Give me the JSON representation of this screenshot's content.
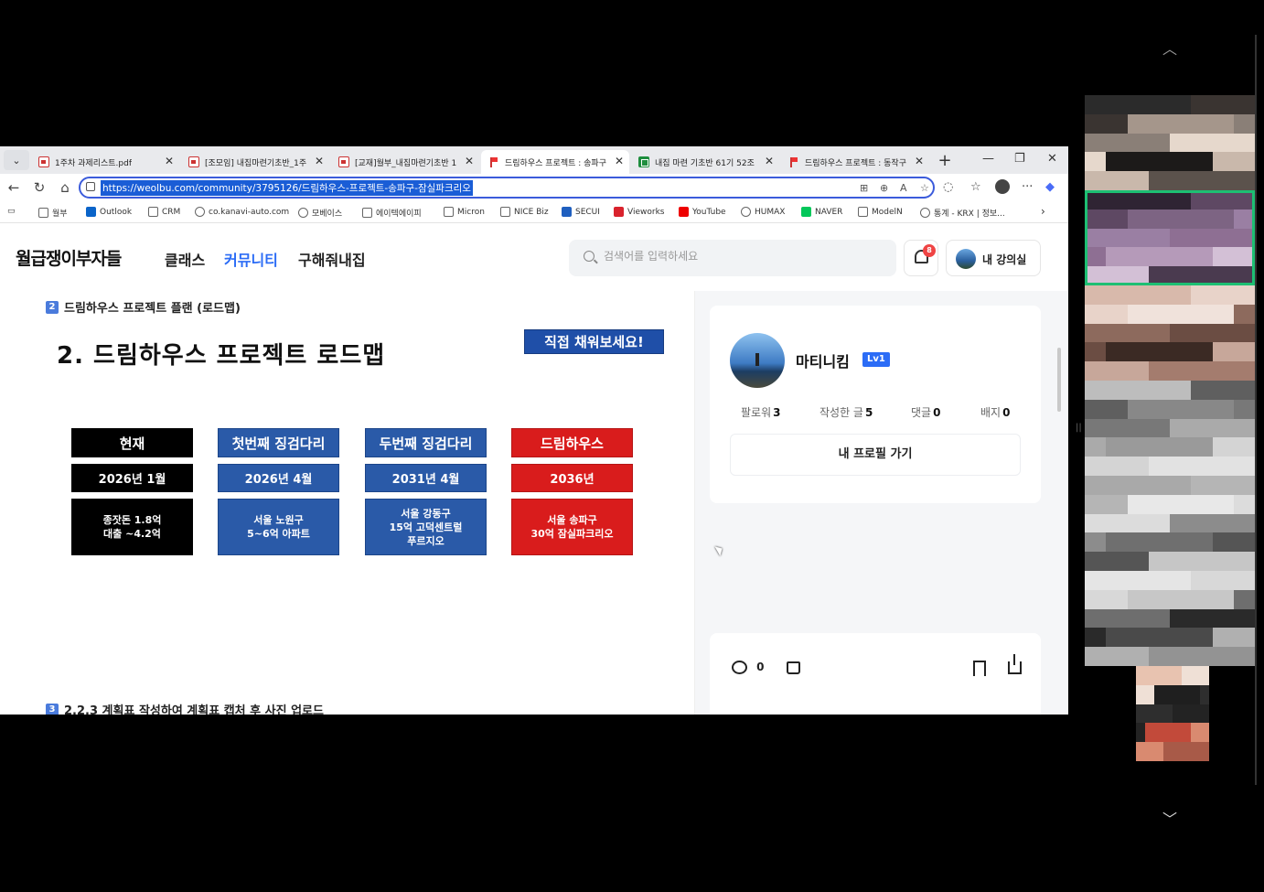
{
  "browser": {
    "tabs": [
      {
        "label": "1주차 과제리스트.pdf",
        "icon": "pdf-icon",
        "active": false
      },
      {
        "label": "[조모임] 내집마련기초반_1주",
        "icon": "pdf-icon",
        "active": false
      },
      {
        "label": "[교재]월부_내집마련기초반 1",
        "icon": "pdf-icon",
        "active": false
      },
      {
        "label": "드림하우스 프로젝트 : 송파구",
        "icon": "flag-icon",
        "active": true
      },
      {
        "label": "내집 마련 기초반 61기 52조",
        "icon": "sheet-icon",
        "active": false
      },
      {
        "label": "드림하우스 프로젝트 : 동작구",
        "icon": "flag-icon",
        "active": false
      }
    ],
    "url": "https://weolbu.com/community/3795126/드림하우스-프로젝트-송파구-잠실파크리오",
    "bookmarks": [
      {
        "label": "월부",
        "icon": "folder-icon"
      },
      {
        "label": "Outlook",
        "icon": "outlook-icon"
      },
      {
        "label": "CRM",
        "icon": "hand-icon"
      },
      {
        "label": "co.kanavi-auto.com",
        "icon": "globe-icon"
      },
      {
        "label": "모베이스",
        "icon": "globe-icon"
      },
      {
        "label": "에이텍에이피",
        "icon": "iu-icon"
      },
      {
        "label": "Micron",
        "icon": "micron-icon"
      },
      {
        "label": "NICE Biz",
        "icon": "nice-icon"
      },
      {
        "label": "SECUI",
        "icon": "secui-icon"
      },
      {
        "label": "Vieworks",
        "icon": "vieworks-icon"
      },
      {
        "label": "YouTube",
        "icon": "youtube-icon"
      },
      {
        "label": "HUMAX",
        "icon": "globe-icon"
      },
      {
        "label": "NAVER",
        "icon": "naver-icon"
      },
      {
        "label": "ModelN",
        "icon": "modeln-icon"
      },
      {
        "label": "통계 - KRX | 정보...",
        "icon": "globe-icon"
      }
    ]
  },
  "site": {
    "logo": "월급쟁이부자들",
    "nav": [
      {
        "label": "클래스",
        "active": false
      },
      {
        "label": "커뮤니티",
        "active": true
      },
      {
        "label": "구해줘내집",
        "active": false
      }
    ],
    "search_placeholder": "검색어를 입력하세요",
    "notification_count": "8",
    "my_course_label": "내 강의실"
  },
  "slide": {
    "section_number": "2",
    "section_title": "드림하우스 프로젝트 플랜 (로드맵)",
    "title": "2. 드림하우스 프로젝트 로드맵",
    "badge": "직접 채워보세요!",
    "columns": [
      {
        "header": "현재",
        "date": "2026년 1월",
        "body": "종잣돈 1.8억\n대출 ~4.2억",
        "color": "#000000"
      },
      {
        "header": "첫번째 징검다리",
        "date": "2026년 4월",
        "body": "서울 노원구\n5~6억 아파트",
        "color": "#2a5aa8"
      },
      {
        "header": "두번째 징검다리",
        "date": "2031년 4월",
        "body": "서울 강동구\n15억 고덕센트럴\n푸르지오",
        "color": "#2a5aa8"
      },
      {
        "header": "드림하우스",
        "date": "2036년",
        "body": "서울 송파구\n30억 잠실파크리오",
        "color": "#d91c1c"
      }
    ],
    "next_section_number": "3",
    "next_section_title": "2.2.3 계획표 작성하여 계획표 캡처 후 사진 업로드"
  },
  "profile": {
    "name": "마티니킴",
    "level": "Lv1",
    "stats": [
      {
        "label": "팔로워",
        "value": "3"
      },
      {
        "label": "작성한 글",
        "value": "5"
      },
      {
        "label": "댓글",
        "value": "0"
      },
      {
        "label": "배지",
        "value": "0"
      }
    ],
    "profile_button": "내 프로필 가기"
  },
  "actions": {
    "comment_count": "0"
  },
  "colors": {
    "accent": "#2b6cf6",
    "notification_badge": "#ef4444",
    "speaking_outline": "#1dbf73"
  }
}
